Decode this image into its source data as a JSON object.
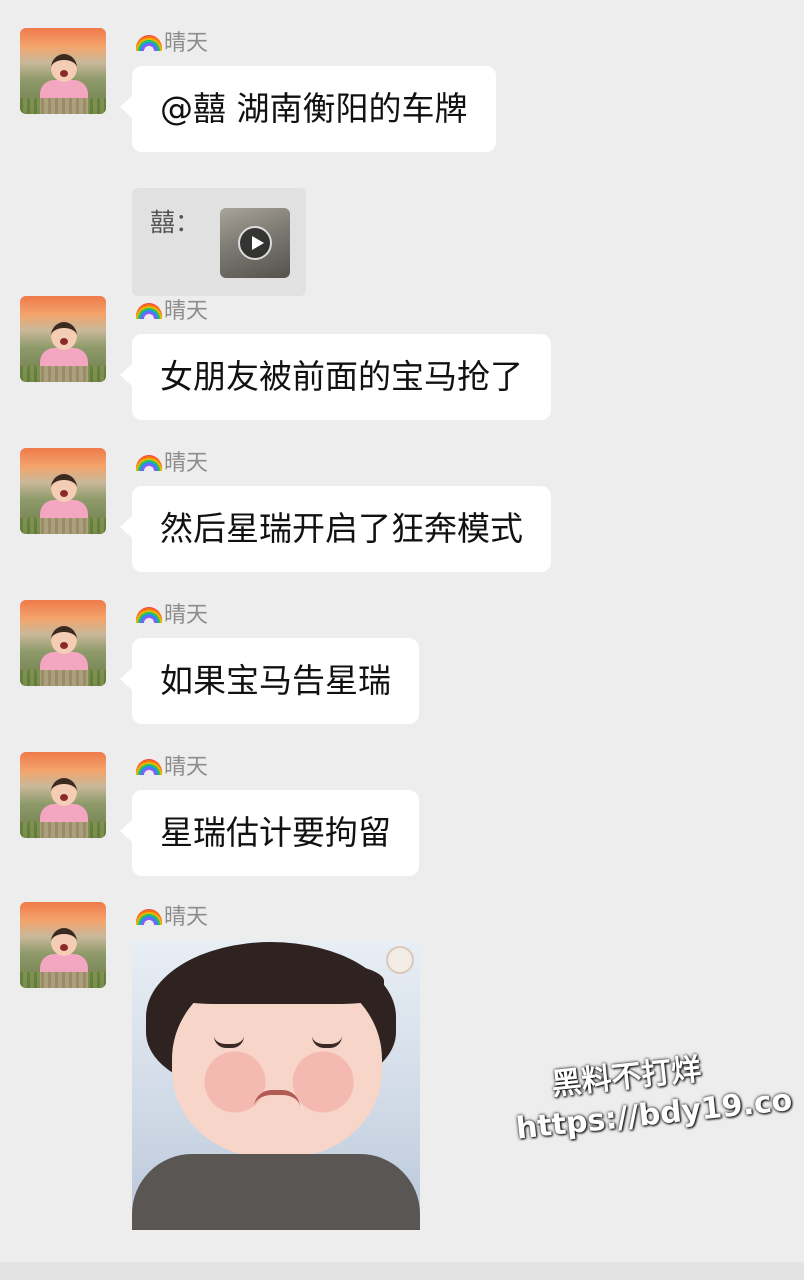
{
  "messages": [
    {
      "sender": "晴天",
      "type": "text",
      "text": "@囍  湖南衡阳的车牌"
    },
    {
      "sender": "晴天",
      "type": "text",
      "text": "女朋友被前面的宝马抢了"
    },
    {
      "sender": "晴天",
      "type": "text",
      "text": "然后星瑞开启了狂奔模式"
    },
    {
      "sender": "晴天",
      "type": "text",
      "text": "如果宝马告星瑞"
    },
    {
      "sender": "晴天",
      "type": "text",
      "text": "星瑞估计要拘留"
    },
    {
      "sender": "晴天",
      "type": "sticker",
      "sticker_desc": "crying-baby"
    }
  ],
  "quote": {
    "name": "囍：",
    "media": "video"
  },
  "watermark": {
    "line1": "黑料不打烊",
    "line2": "https://bdy19.co"
  }
}
